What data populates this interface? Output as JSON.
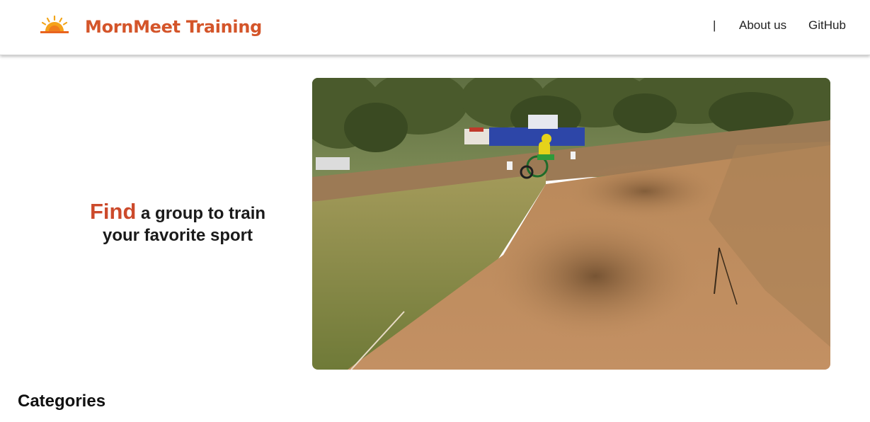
{
  "header": {
    "brand": "MornMeet Training",
    "logo_icon": "sunrise-icon",
    "brand_color": "#d4552a",
    "nav": {
      "separator": "|",
      "about": "About us",
      "github": "GitHub"
    }
  },
  "hero": {
    "highlight": "Find",
    "line1_rest": " a group to train",
    "line2": "your favorite sport",
    "highlight_color": "#cc4a2b",
    "media": "motocross-video"
  },
  "sections": {
    "categories_title": "Categories"
  }
}
